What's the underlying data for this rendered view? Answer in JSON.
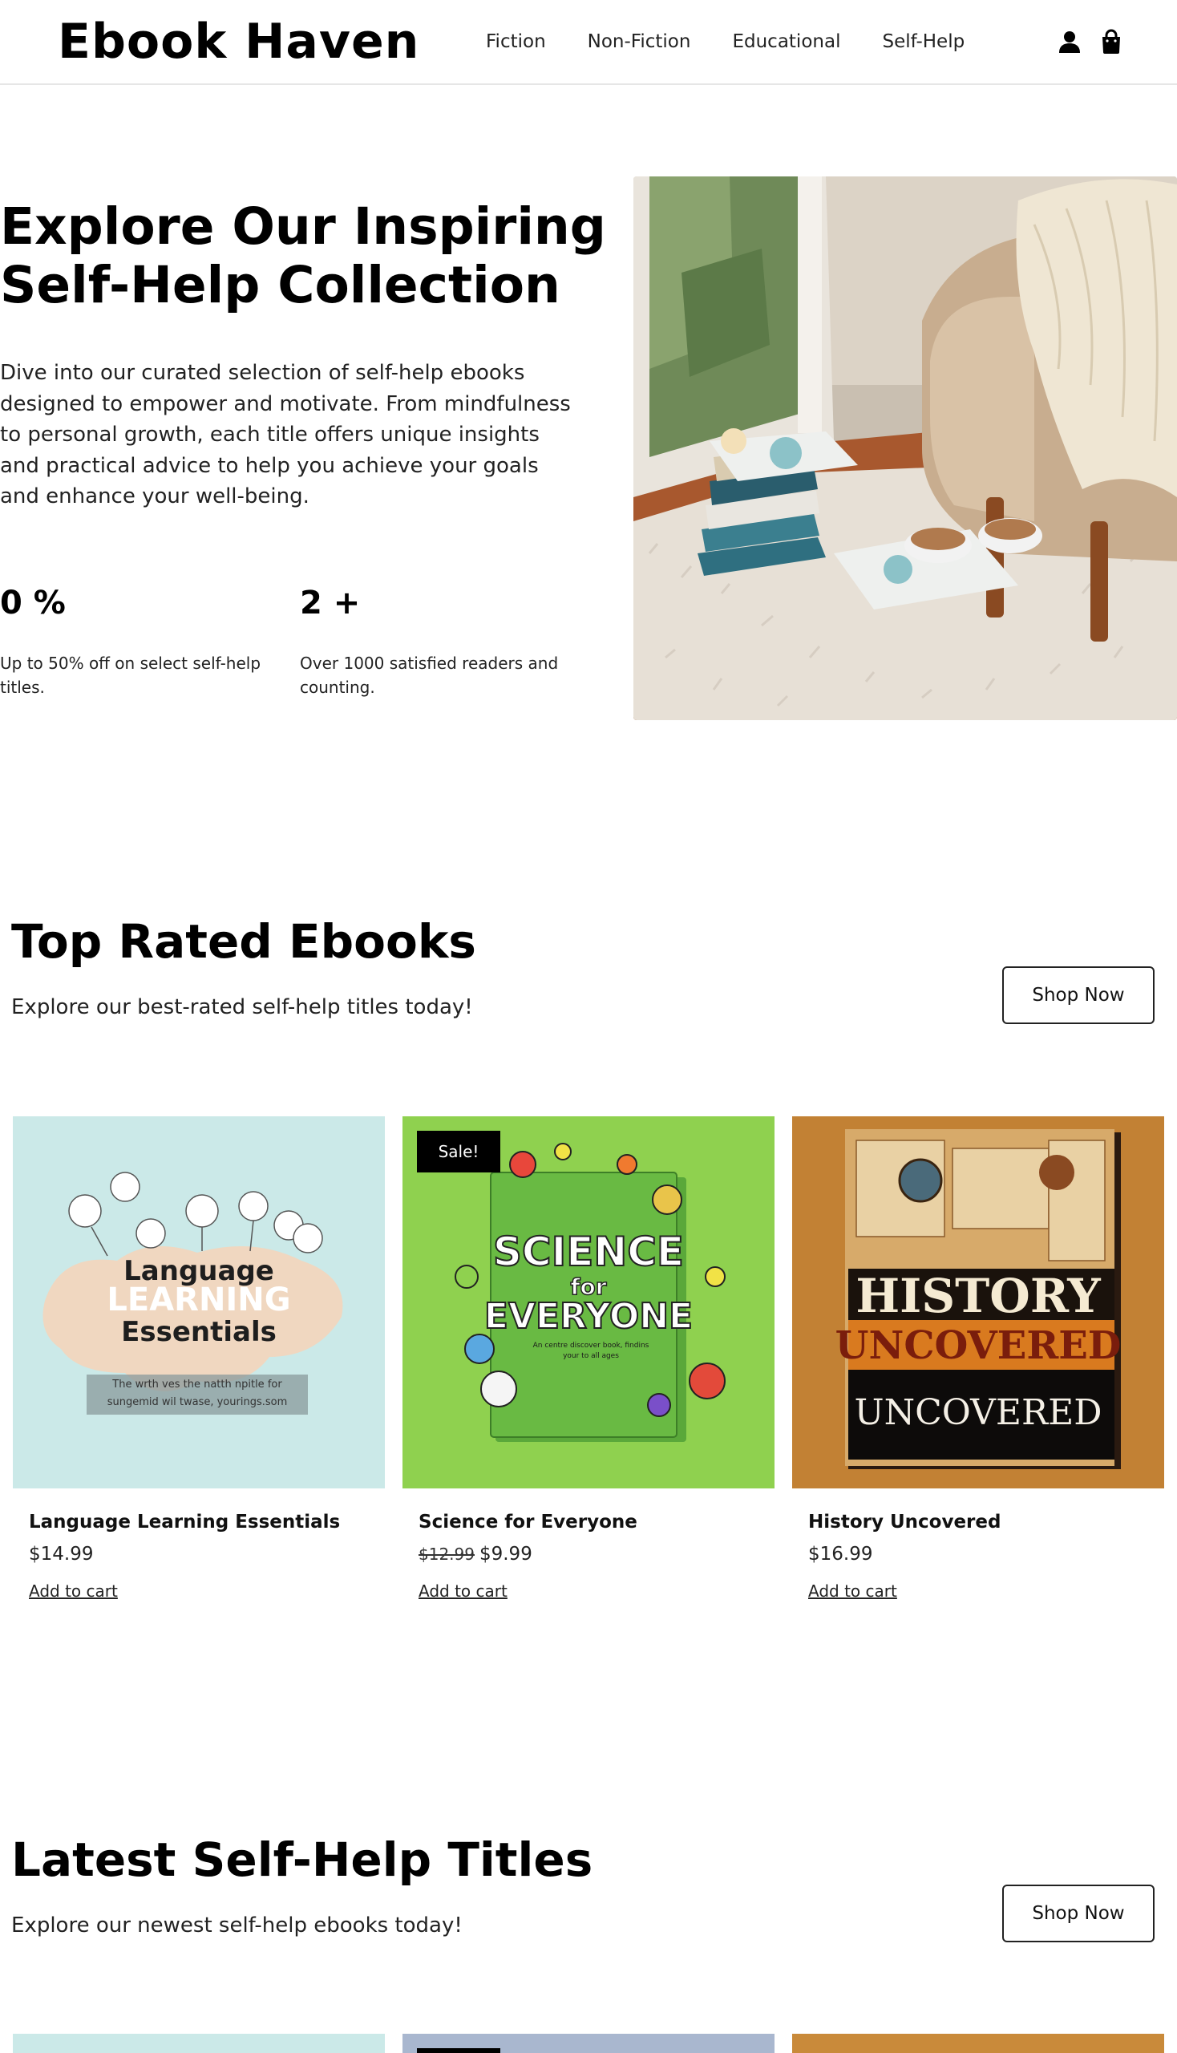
{
  "header": {
    "logo": "Ebook Haven",
    "nav": [
      "Fiction",
      "Non-Fiction",
      "Educational",
      "Self-Help"
    ],
    "icons": [
      "user-icon",
      "shopping-bag-icon"
    ]
  },
  "hero": {
    "title_line1": "Explore Our Inspiring",
    "title_line2": "Self-Help Collection",
    "description": "Dive into our curated selection of self-help ebooks designed to empower and motivate. From mindfulness to personal growth, each title offers unique insights and practical advice to help you achieve your goals and enhance your well-being.",
    "stats": [
      {
        "value": "0 %",
        "label": "Up to 50% off on select self-help titles."
      },
      {
        "value": "2 +",
        "label": "Over 1000 satisfied readers and counting."
      }
    ]
  },
  "top_rated": {
    "title": "Top Rated Ebooks",
    "subtitle": "Explore our best-rated self-help titles today!",
    "button": "Shop Now",
    "products": [
      {
        "name": "Language Learning Essentials",
        "price": "$14.99",
        "old_price": "",
        "cart": "Add to cart",
        "badge": "",
        "cover": {
          "line1": "Language",
          "line2": "LEARNING",
          "line3": "Essentials",
          "note": "The wrth ves the natth npitle for sungemid wil twase, yourings.som"
        }
      },
      {
        "name": "Science for Everyone",
        "price": "$9.99",
        "old_price": "$12.99",
        "cart": "Add to cart",
        "badge": "Sale!",
        "cover": {
          "line1": "SCIENCE",
          "line2": "for",
          "line3": "EVERYONE",
          "note": "An centre discover book, findins your to all ages"
        }
      },
      {
        "name": "History Uncovered",
        "price": "$16.99",
        "old_price": "",
        "cart": "Add to cart",
        "badge": "",
        "cover": {
          "line1": "HISTORY",
          "line2": "UNCOVERED",
          "line3": "UNCOVERED",
          "note": ""
        }
      }
    ]
  },
  "latest": {
    "title": "Latest Self-Help Titles",
    "subtitle": "Explore our newest self-help ebooks today!",
    "button": "Shop Now"
  },
  "colors": {
    "text": "#111111",
    "border": "#e6e6e6",
    "badge_bg": "#000000",
    "cover1_bg": "#c9e8e6",
    "cover2_bg": "#8fd14f",
    "cover3_bg": "#c98a3a"
  }
}
